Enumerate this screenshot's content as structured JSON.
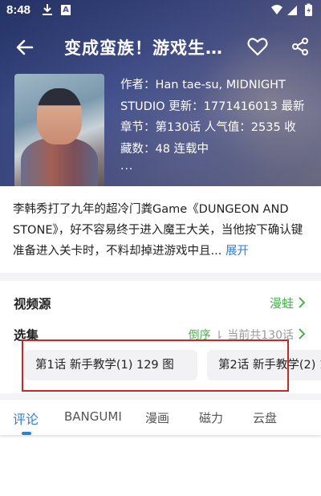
{
  "status_bar": {
    "time": "8:48",
    "notification_a": "A",
    "icons": [
      "download-icon",
      "wifi-icon",
      "signal-icon",
      "battery-charging-icon"
    ]
  },
  "toolbar": {
    "title": "变成蛮族！游戏生…",
    "icons": [
      "back-arrow-icon",
      "heart-icon",
      "share-icon"
    ]
  },
  "info": {
    "line1": "作者：Han tae-su, MIDNIGHT",
    "line2": "STUDIO 更新：1771416013 最新",
    "line3": "章节：第130话 人气值：2535 收",
    "line4": "藏数：48 连载中",
    "more": "..."
  },
  "description": {
    "text": "李韩秀打了九年的超冷门粪Game《DUNGEON AND STONE》，好不容易终于进入魔王大关，当他按下确认键准备进入关卡时，不料却掉进游戏中且...",
    "expand_label": "展开"
  },
  "video_source": {
    "label": "视频源",
    "value": "漫蛙"
  },
  "episodes": {
    "label": "选集",
    "sort_label": "倒序",
    "sort_icon": "sort-icon",
    "current_label": "当前共130话",
    "items": [
      {
        "label": "第1话 新手教学(1) 129 图"
      },
      {
        "label": "第2话 新手教学(2) 1"
      }
    ]
  },
  "tabs": [
    {
      "label": "评论",
      "active": true
    },
    {
      "label": "BANGUMI",
      "active": false
    },
    {
      "label": "漫画",
      "active": false
    },
    {
      "label": "磁力",
      "active": false
    },
    {
      "label": "云盘",
      "active": false
    }
  ],
  "colors": {
    "accent_blue": "#2f7fd3",
    "accent_green": "#4caf50",
    "highlight_red": "#c62828"
  }
}
